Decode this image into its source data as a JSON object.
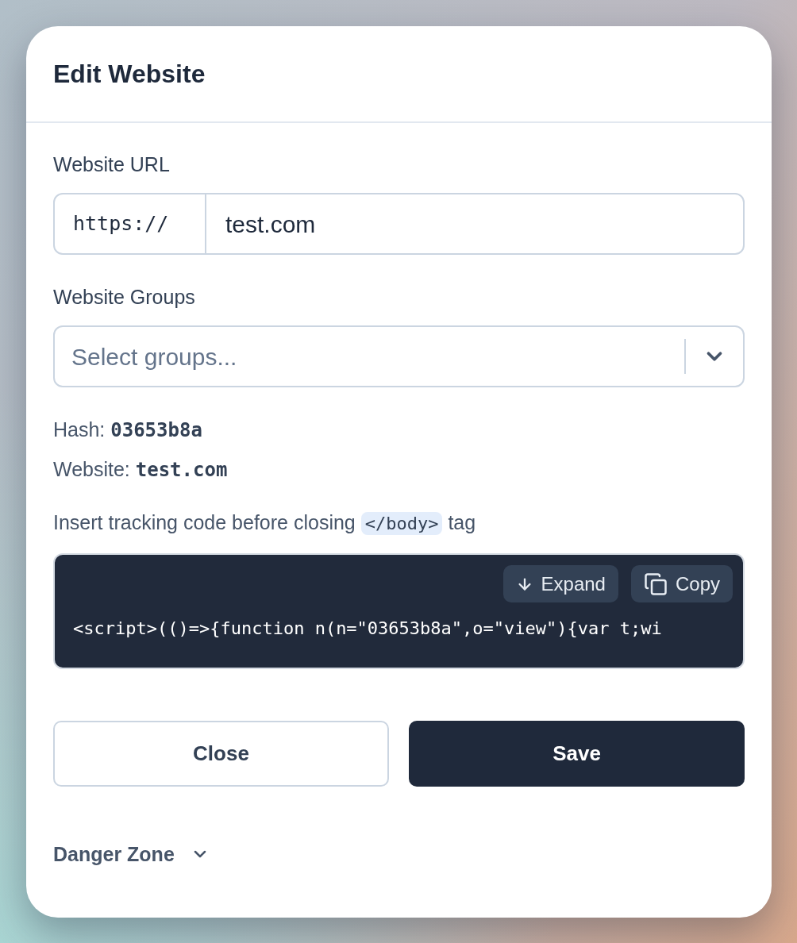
{
  "dialog": {
    "title": "Edit Website"
  },
  "url_field": {
    "label": "Website URL",
    "prefix": "https://",
    "value": "test.com"
  },
  "groups_field": {
    "label": "Website Groups",
    "placeholder": "Select groups..."
  },
  "details": [
    {
      "label": "Hash:",
      "value": "03653b8a"
    },
    {
      "label": "Website:",
      "value": "test.com"
    }
  ],
  "tracking": {
    "before": "Insert tracking code before closing",
    "code": "</body>",
    "after": "tag",
    "snippet": "<script>(()=>{function n(n=\"03653b8a\",o=\"view\"){var t;wi",
    "buttons": [
      {
        "label": "Expand",
        "kind": "expand"
      },
      {
        "label": "Copy",
        "kind": "copy"
      }
    ]
  },
  "actions": [
    {
      "label": "Close",
      "kind": "secondary"
    },
    {
      "label": "Save",
      "kind": "primary"
    }
  ],
  "danger_zone": {
    "label": "Danger Zone",
    "expanded": false
  }
}
